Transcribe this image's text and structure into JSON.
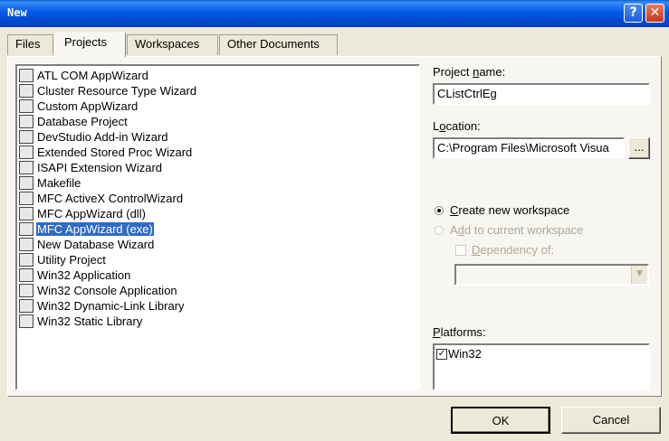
{
  "window": {
    "title": "New",
    "help_label": "?",
    "close_label": "✕"
  },
  "tabs": [
    "Files",
    "Projects",
    "Workspaces",
    "Other Documents"
  ],
  "project_types": [
    {
      "label": "ATL COM AppWizard",
      "icon": "atl-icon"
    },
    {
      "label": "Cluster Resource Type Wizard",
      "icon": "cluster-icon"
    },
    {
      "label": "Custom AppWizard",
      "icon": "custom-wizard-icon"
    },
    {
      "label": "Database Project",
      "icon": "database-icon"
    },
    {
      "label": "DevStudio Add-in Wizard",
      "icon": "addin-icon"
    },
    {
      "label": "Extended Stored Proc Wizard",
      "icon": "stored-proc-icon"
    },
    {
      "label": "ISAPI Extension Wizard",
      "icon": "isapi-globe-icon"
    },
    {
      "label": "Makefile",
      "icon": "makefile-icon"
    },
    {
      "label": "MFC ActiveX ControlWizard",
      "icon": "activex-icon"
    },
    {
      "label": "MFC AppWizard (dll)",
      "icon": "mfc-dll-icon"
    },
    {
      "label": "MFC AppWizard (exe)",
      "icon": "mfc-exe-icon"
    },
    {
      "label": "New Database Wizard",
      "icon": "new-database-icon"
    },
    {
      "label": "Utility Project",
      "icon": "utility-icon"
    },
    {
      "label": "Win32 Application",
      "icon": "win32-app-icon"
    },
    {
      "label": "Win32 Console Application",
      "icon": "console-icon"
    },
    {
      "label": "Win32 Dynamic-Link Library",
      "icon": "dll-icon"
    },
    {
      "label": "Win32 Static Library",
      "icon": "static-lib-icon"
    }
  ],
  "selected_index": 10,
  "project_name": {
    "label_pre": "Project ",
    "label_u": "n",
    "label_post": "ame:",
    "value": "CListCtrlEg"
  },
  "location": {
    "label_pre": "L",
    "label_u": "o",
    "label_post": "cation:",
    "value": "C:\\Program Files\\Microsoft Visua",
    "browse_label": "..."
  },
  "workspace": {
    "create_pre": "",
    "create_u": "C",
    "create_post": "reate new workspace",
    "add_pre": "A",
    "add_u": "d",
    "add_post": "d to current workspace",
    "dependency_pre": "",
    "dependency_u": "D",
    "dependency_post": "ependency of:",
    "dependency_value": ""
  },
  "platforms": {
    "label_pre": "",
    "label_u": "P",
    "label_post": "latforms:",
    "items": [
      "Win32"
    ]
  },
  "buttons": {
    "ok": "OK",
    "cancel": "Cancel"
  },
  "colors": {
    "title_bar": "#0054E3",
    "selection": "#316AC5",
    "dialog_bg": "#ECE9D8"
  }
}
